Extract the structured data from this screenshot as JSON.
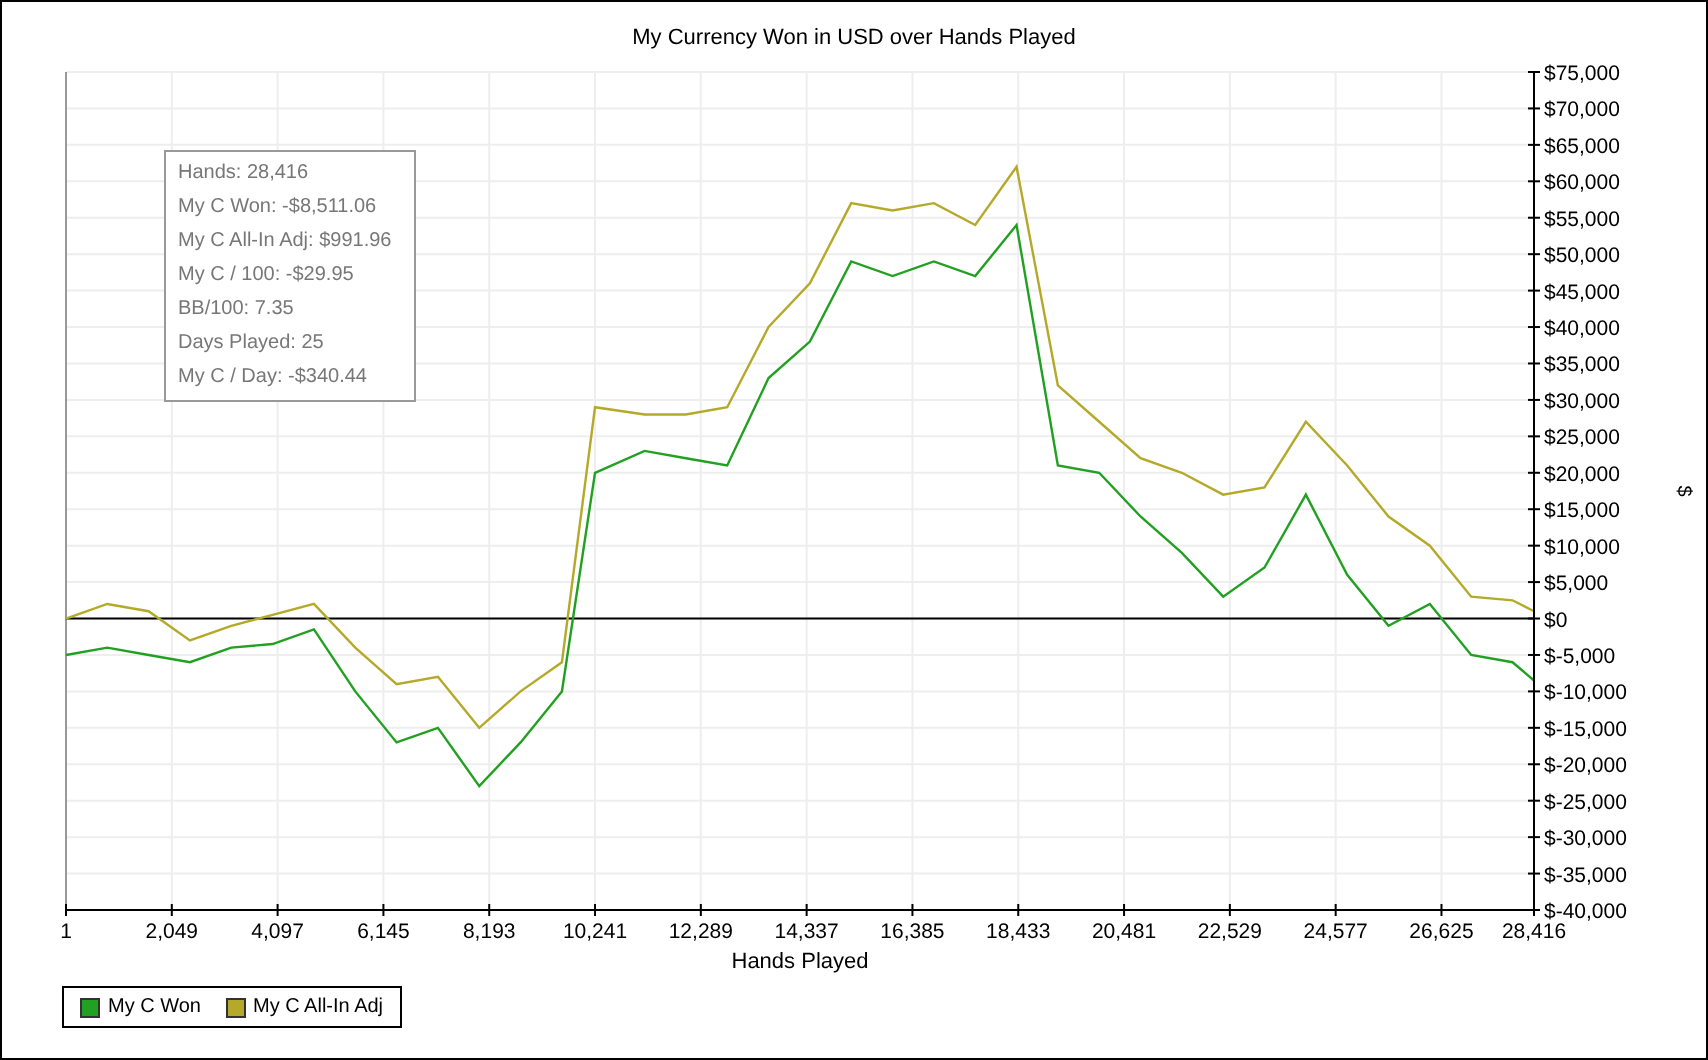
{
  "chart": {
    "chart_data": {
      "type": "line",
      "title": "My Currency Won in USD over Hands Played",
      "xlabel": "Hands Played",
      "ylabel": "$",
      "x": [
        1,
        800,
        1600,
        2400,
        3200,
        4000,
        4800,
        5600,
        6400,
        7200,
        8000,
        8800,
        9600,
        10241,
        11200,
        12000,
        12800,
        13600,
        14400,
        15200,
        16000,
        16800,
        17600,
        18400,
        19200,
        20000,
        20800,
        21600,
        22400,
        23200,
        24000,
        24800,
        25600,
        26400,
        27200,
        28000,
        28416
      ],
      "series": [
        {
          "name": "My C Won",
          "color": "#22a022",
          "values": [
            -5000,
            -4000,
            -5000,
            -6000,
            -4000,
            -3500,
            -1500,
            -10000,
            -17000,
            -15000,
            -23000,
            -17000,
            -10000,
            20000,
            23000,
            22000,
            21000,
            33000,
            38000,
            49000,
            47000,
            49000,
            47000,
            54000,
            21000,
            20000,
            14000,
            9000,
            3000,
            7000,
            17000,
            6000,
            -1000,
            2000,
            -5000,
            -6000,
            -8500
          ]
        },
        {
          "name": "My C All-In Adj",
          "color": "#b5a92a",
          "values": [
            0,
            2000,
            1000,
            -3000,
            -1000,
            500,
            2000,
            -4000,
            -9000,
            -8000,
            -15000,
            -10000,
            -6000,
            29000,
            28000,
            28000,
            29000,
            40000,
            46000,
            57000,
            56000,
            57000,
            54000,
            62000,
            32000,
            27000,
            22000,
            20000,
            17000,
            18000,
            27000,
            21000,
            14000,
            10000,
            3000,
            2500,
            1000
          ]
        }
      ],
      "grid": true,
      "xlim": [
        1,
        28416
      ],
      "ylim": [
        -40000,
        75000
      ],
      "xticks": [
        {
          "value": 1,
          "label": "1"
        },
        {
          "value": 2049,
          "label": "2,049"
        },
        {
          "value": 4097,
          "label": "4,097"
        },
        {
          "value": 6145,
          "label": "6,145"
        },
        {
          "value": 8193,
          "label": "8,193"
        },
        {
          "value": 10241,
          "label": "10,241"
        },
        {
          "value": 12289,
          "label": "12,289"
        },
        {
          "value": 14337,
          "label": "14,337"
        },
        {
          "value": 16385,
          "label": "16,385"
        },
        {
          "value": 18433,
          "label": "18,433"
        },
        {
          "value": 20481,
          "label": "20,481"
        },
        {
          "value": 22529,
          "label": "22,529"
        },
        {
          "value": 24577,
          "label": "24,577"
        },
        {
          "value": 26625,
          "label": "26,625"
        },
        {
          "value": 28416,
          "label": "28,416"
        }
      ],
      "yticks": [
        {
          "value": 75000,
          "label": "$75,000"
        },
        {
          "value": 70000,
          "label": "$70,000"
        },
        {
          "value": 65000,
          "label": "$65,000"
        },
        {
          "value": 60000,
          "label": "$60,000"
        },
        {
          "value": 55000,
          "label": "$55,000"
        },
        {
          "value": 50000,
          "label": "$50,000"
        },
        {
          "value": 45000,
          "label": "$45,000"
        },
        {
          "value": 40000,
          "label": "$40,000"
        },
        {
          "value": 35000,
          "label": "$35,000"
        },
        {
          "value": 30000,
          "label": "$30,000"
        },
        {
          "value": 25000,
          "label": "$25,000"
        },
        {
          "value": 20000,
          "label": "$20,000"
        },
        {
          "value": 15000,
          "label": "$15,000"
        },
        {
          "value": 10000,
          "label": "$10,000"
        },
        {
          "value": 5000,
          "label": "$5,000"
        },
        {
          "value": 0,
          "label": "$0"
        },
        {
          "value": -5000,
          "label": "$-5,000"
        },
        {
          "value": -10000,
          "label": "$-10,000"
        },
        {
          "value": -15000,
          "label": "$-15,000"
        },
        {
          "value": -20000,
          "label": "$-20,000"
        },
        {
          "value": -25000,
          "label": "$-25,000"
        },
        {
          "value": -30000,
          "label": "$-30,000"
        },
        {
          "value": -35000,
          "label": "$-35,000"
        },
        {
          "value": -40000,
          "label": "$-40,000"
        }
      ]
    },
    "tooltip": [
      "Hands: 28,416",
      "My C Won: -$8,511.06",
      "My C All-In Adj: $991.96",
      "My C / 100: -$29.95",
      "BB/100: 7.35",
      "Days Played: 25",
      "My C / Day: -$340.44"
    ]
  }
}
